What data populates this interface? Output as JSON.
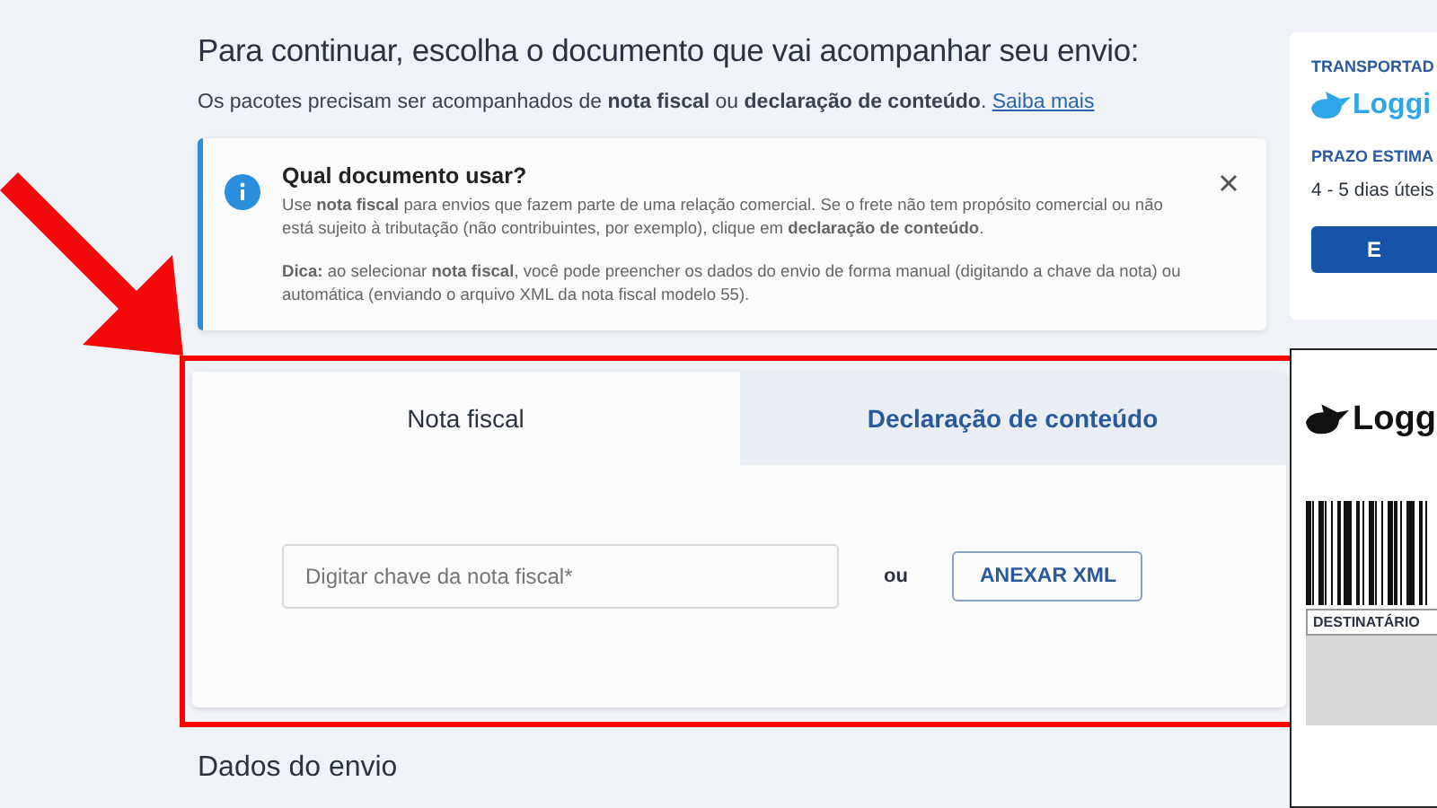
{
  "heading": "Para continuar, escolha o documento que vai acompanhar seu envio:",
  "intro": {
    "text": "Os pacotes precisam ser acompanhados de **nota fiscal** ou **declaração de conteúdo**.",
    "link": "Saiba mais"
  },
  "info_box": {
    "title": "Qual documento usar?",
    "paragraphs": [
      "Use **nota fiscal** para envios que fazem parte de uma relação comercial. Se o frete não tem propósito comercial ou não está sujeito à tributação (não contribuintes, por exemplo), clique em **declaração de conteúdo**.",
      "**Dica:** ao selecionar **nota fiscal**, você pode preencher os dados do envio de forma manual (digitando a chave da nota) ou automática (enviando o arquivo XML da nota fiscal modelo 55)."
    ]
  },
  "tabs": [
    {
      "label": "Nota fiscal",
      "selected": true
    },
    {
      "label": "Declaração de conteúdo",
      "selected": false
    }
  ],
  "invoice": {
    "placeholder": "Digitar chave da nota fiscal*",
    "separator": "ou",
    "button": "ANEXAR XML"
  },
  "section_title": "Dados do envio",
  "carrier_card": {
    "label": "TRANSPORTAD",
    "logo": "Loggi",
    "eta_label": "PRAZO ESTIMA",
    "eta": "4 - 5 dias úteis",
    "button": "E"
  },
  "shipping_label": {
    "logo": "Logg",
    "recipient": "DESTINATÁRIO"
  }
}
